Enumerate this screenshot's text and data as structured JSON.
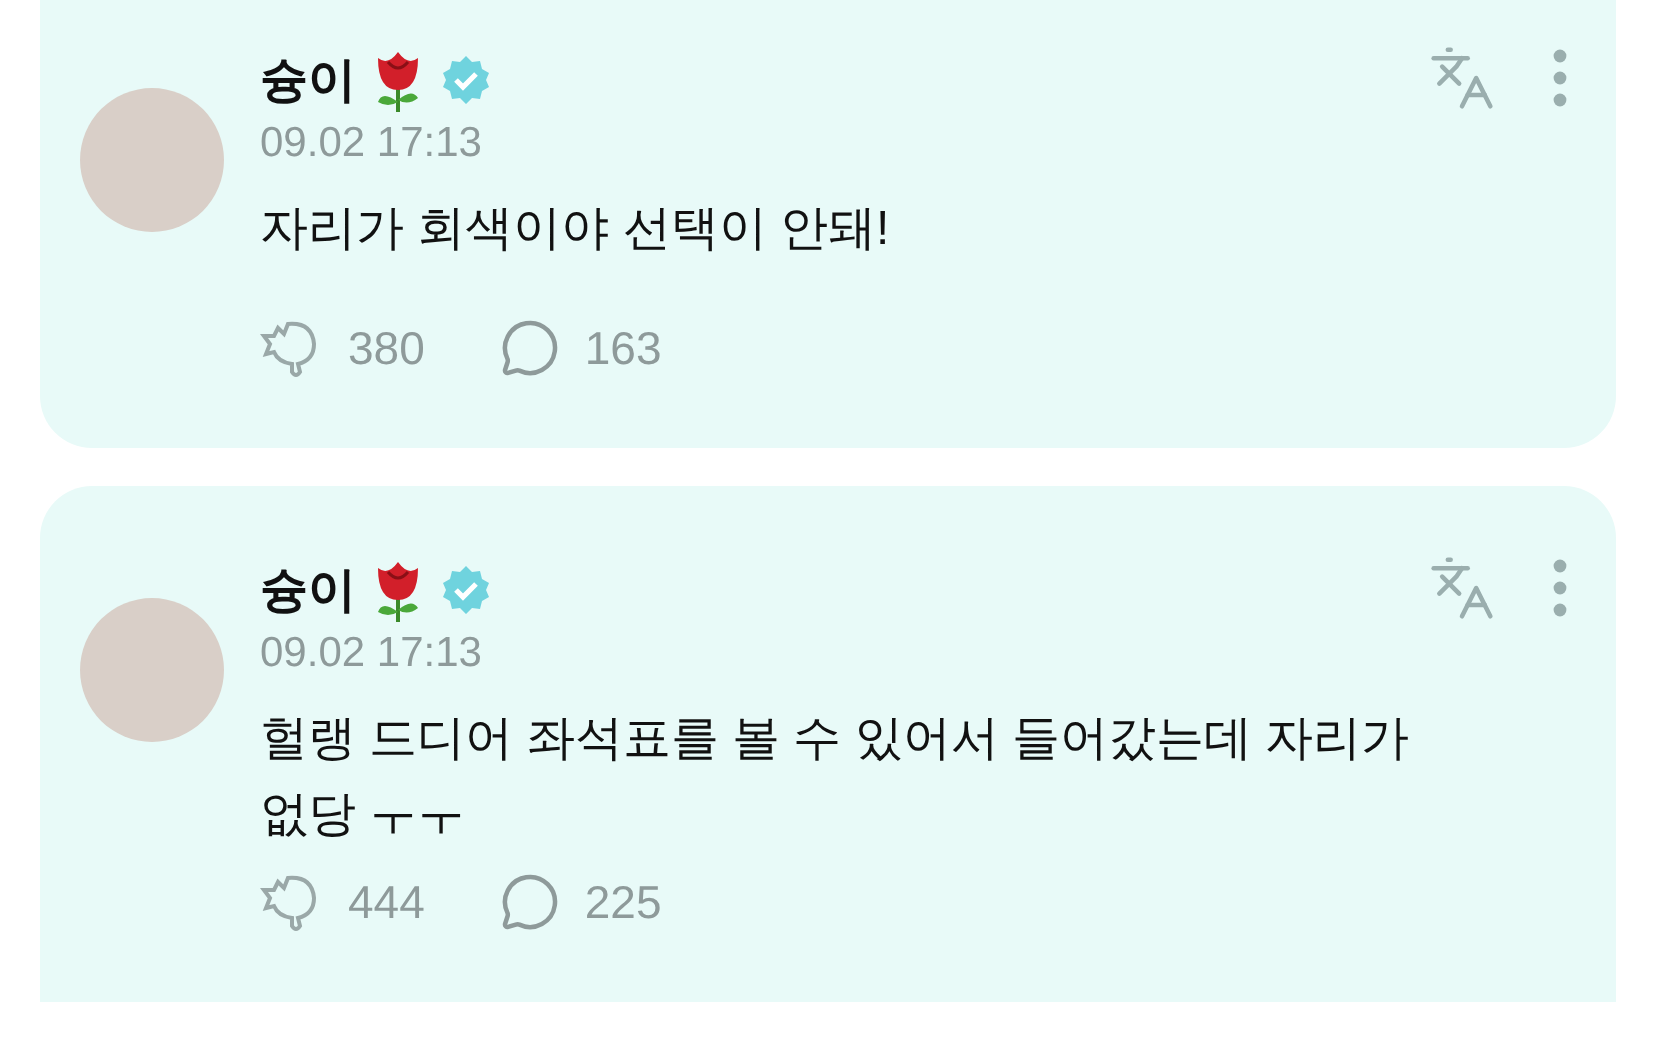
{
  "posts": [
    {
      "author": {
        "name": "슝이",
        "verified": true
      },
      "time": "09.02 17:13",
      "text": "자리가 회색이야 선택이 안돼!",
      "reposts": "380",
      "comments": "163"
    },
    {
      "author": {
        "name": "슝이",
        "verified": true
      },
      "time": "09.02 17:13",
      "text": "헐랭 드디어 좌석표를 볼 수 있어서 들어갔는데 자리가 없당 ㅜㅜ",
      "reposts": "444",
      "comments": "225"
    }
  ]
}
